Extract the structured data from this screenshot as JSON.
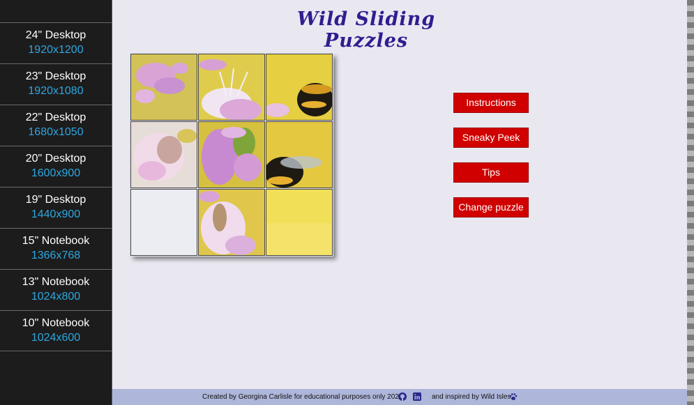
{
  "title": "Wild  Sliding  Puzzles",
  "sidebar": {
    "items": [
      {
        "name": "24\" Desktop",
        "res": "1920x1200"
      },
      {
        "name": "23\" Desktop",
        "res": "1920x1080"
      },
      {
        "name": "22\" Desktop",
        "res": "1680x1050"
      },
      {
        "name": "20\" Desktop",
        "res": "1600x900"
      },
      {
        "name": "19\" Desktop",
        "res": "1440x900"
      },
      {
        "name": "15\" Notebook",
        "res": "1366x768"
      },
      {
        "name": "13\" Notebook",
        "res": "1024x800"
      },
      {
        "name": "10\" Notebook",
        "res": "1024x600"
      }
    ]
  },
  "buttons": {
    "instructions": "Instructions",
    "sneaky_peek": "Sneaky Peek",
    "tips": "Tips",
    "change_puzzle": "Change puzzle"
  },
  "puzzle": {
    "grid": "3x3",
    "empty_tile": "row 3, col 1",
    "image_subject": "bumblebee on pink flower"
  },
  "footer": {
    "created": "Created by Georgina Carlisle for educational purposes only 2023",
    "inspired": "and inspired by Wild Isles",
    "icons": [
      "github-icon",
      "linkedin-icon",
      "paw-icon"
    ]
  },
  "colors": {
    "sidebar_bg": "#1c1c1c",
    "resolution_text": "#2ea7e0",
    "title": "#2f1d8f",
    "button_bg": "#d10000",
    "footer_bg": "#aeb6da",
    "page_bg": "#e9e8f1"
  }
}
